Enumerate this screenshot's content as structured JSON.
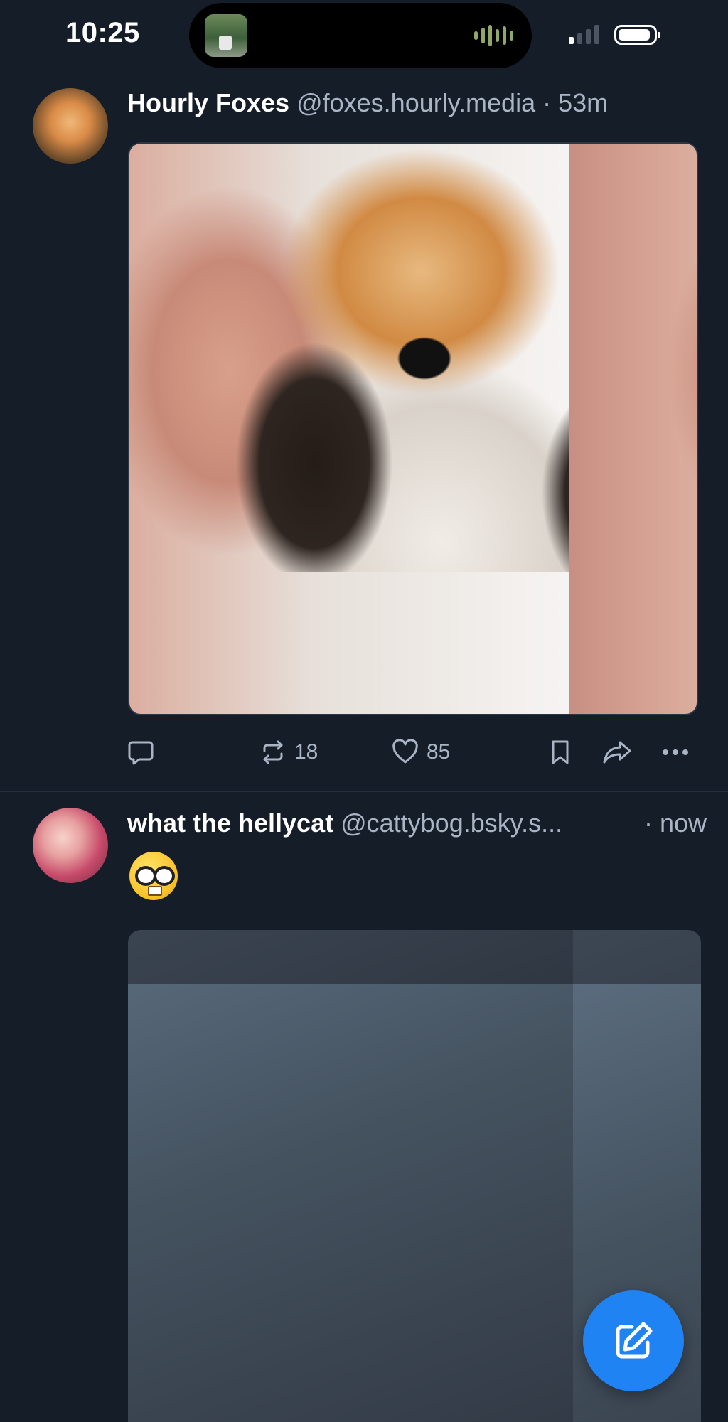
{
  "status_bar": {
    "time": "10:25",
    "signal_bars_active": 1,
    "signal_bars_total": 4,
    "battery_level": 0.9
  },
  "posts": [
    {
      "author": "Hourly Foxes",
      "handle": "@foxes.hourly.media",
      "time": "· 53m",
      "actions": {
        "reply_count": "",
        "repost_count": "18",
        "like_count": "85"
      }
    },
    {
      "author": "what the hellycat",
      "handle": "@cattybog.bsky.s...",
      "time": "· now",
      "emoji_text": "🤓"
    }
  ],
  "icons": {
    "reply": "speech-bubble-icon",
    "repost": "repost-icon",
    "like": "heart-icon",
    "bookmark": "bookmark-icon",
    "share": "share-icon",
    "more": "more-icon",
    "compose": "compose-icon"
  },
  "colors": {
    "background": "#151d28",
    "muted_text": "#a9b5c4",
    "accent": "#1f83f4"
  }
}
